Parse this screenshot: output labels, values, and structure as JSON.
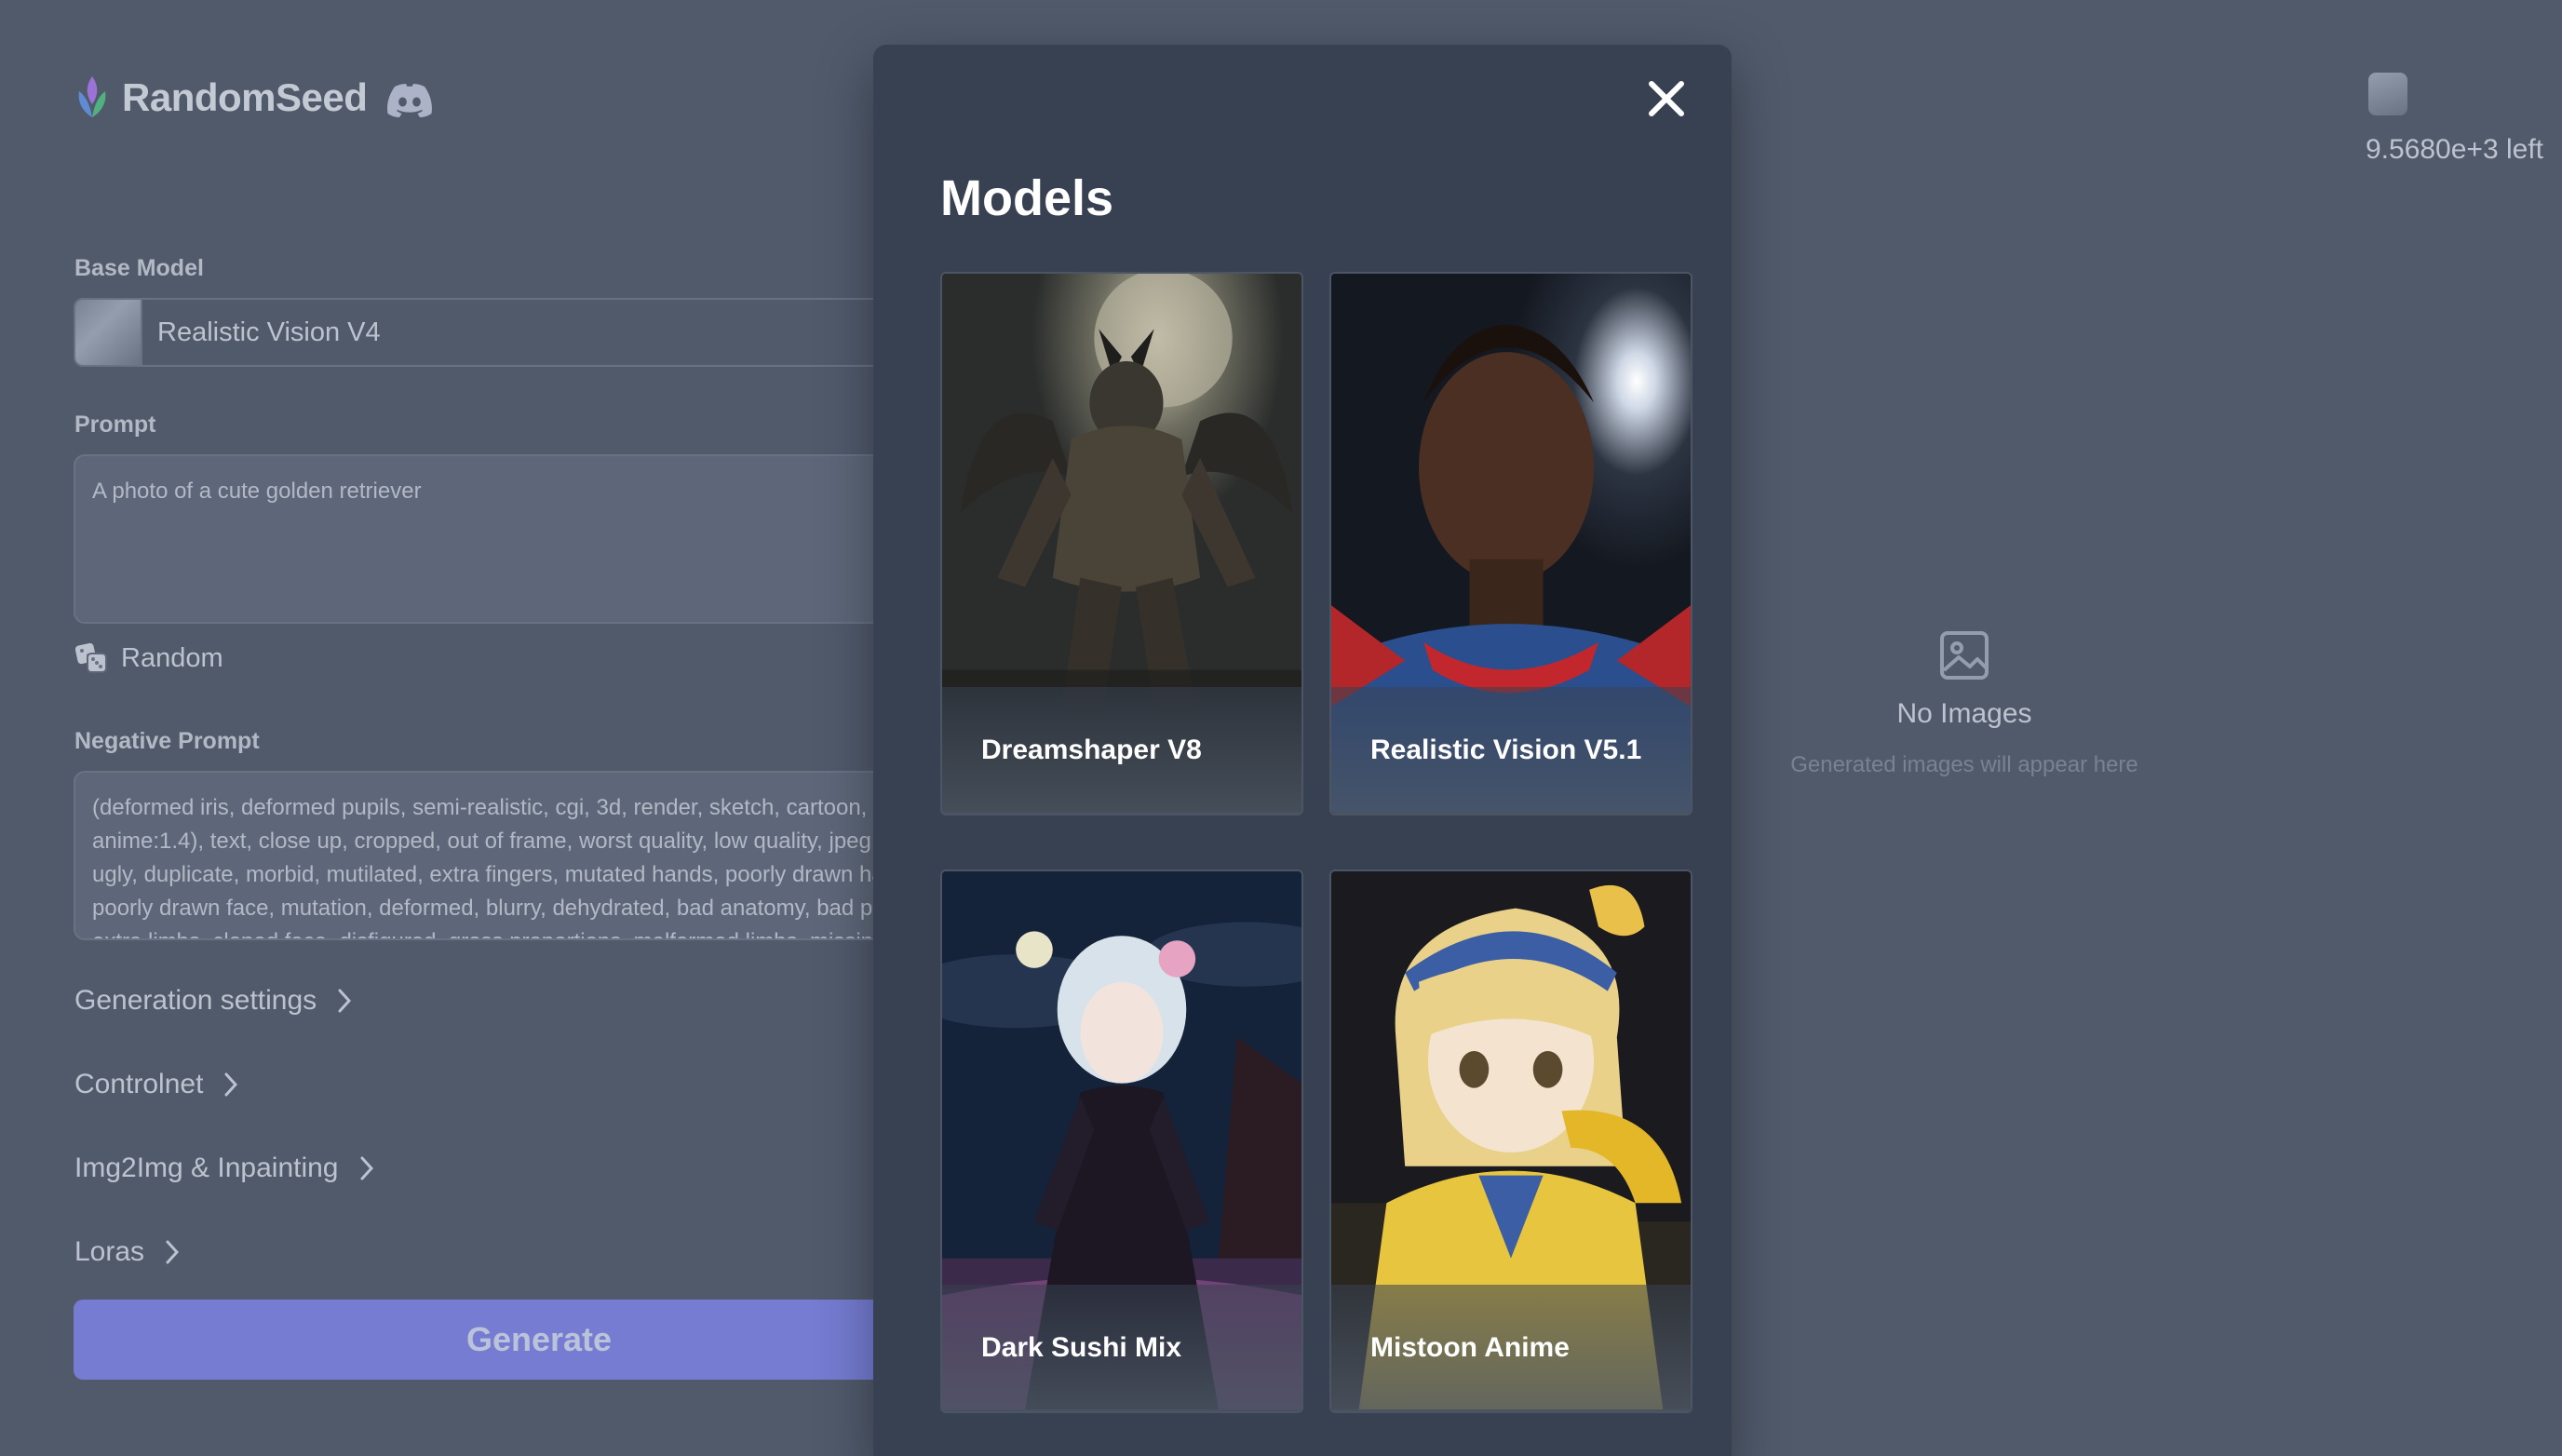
{
  "app": {
    "logo_text": "RandomSeed",
    "base_model_label": "Base Model",
    "base_model_value": "Realistic Vision V4",
    "prompt_label": "Prompt",
    "prompt_placeholder": "A photo of a cute golden retriever",
    "random_label": "Random",
    "negative_prompt_label": "Negative Prompt",
    "negative_prompt_value": "(deformed iris, deformed pupils, semi-realistic, cgi, 3d, render, sketch, cartoon, drawing, anime:1.4), text, close up, cropped, out of frame, worst quality, low quality, jpeg artifacts, ugly, duplicate, morbid, mutilated, extra fingers, mutated hands, poorly drawn hands, poorly drawn face, mutation, deformed, blurry, dehydrated, bad anatomy, bad proportions, extra limbs, cloned face, disfigured, gross proportions, malformed limbs, missing arms, missing legs, extra arms, extra legs",
    "sections": [
      "Generation settings",
      "Controlnet",
      "Img2Img & Inpainting",
      "Loras"
    ],
    "generate_label": "Generate",
    "credits_text": "9.5680e+3 left",
    "empty_title": "No Images",
    "empty_subtitle": "Generated images will appear here"
  },
  "modal": {
    "title": "Models",
    "models": [
      {
        "name": "Dreamshaper V8"
      },
      {
        "name": "Realistic Vision V5.1"
      },
      {
        "name": "Dark Sushi Mix"
      },
      {
        "name": "Mistoon Anime"
      }
    ]
  },
  "colors": {
    "accent": "#6366f1",
    "background": "#1f2937",
    "modal": "#374151"
  }
}
